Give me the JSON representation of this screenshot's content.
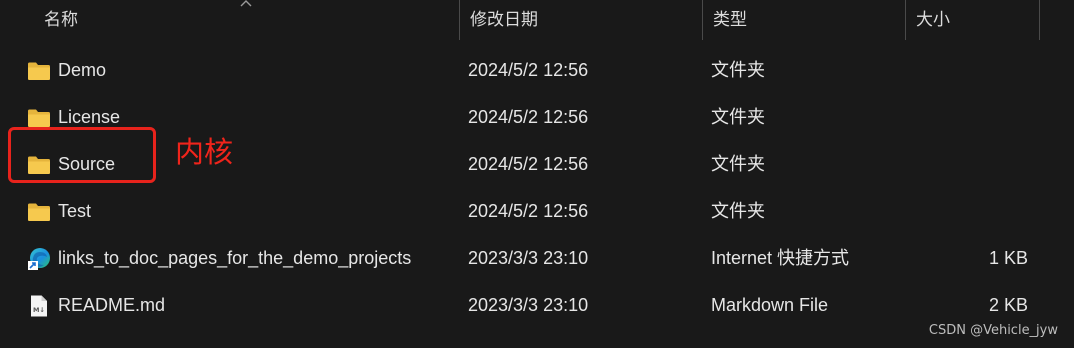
{
  "header": {
    "name": "名称",
    "date": "修改日期",
    "type": "类型",
    "size": "大小"
  },
  "rows": [
    {
      "name": "Demo",
      "date": "2024/5/2 12:56",
      "type": "文件夹",
      "size": "",
      "icon": "folder-icon"
    },
    {
      "name": "License",
      "date": "2024/5/2 12:56",
      "type": "文件夹",
      "size": "",
      "icon": "folder-icon"
    },
    {
      "name": "Source",
      "date": "2024/5/2 12:56",
      "type": "文件夹",
      "size": "",
      "icon": "folder-icon"
    },
    {
      "name": "Test",
      "date": "2024/5/2 12:56",
      "type": "文件夹",
      "size": "",
      "icon": "folder-icon"
    },
    {
      "name": "links_to_doc_pages_for_the_demo_projects",
      "date": "2023/3/3 23:10",
      "type": "Internet 快捷方式",
      "size": "1 KB",
      "icon": "internet-shortcut-icon"
    },
    {
      "name": "README.md",
      "date": "2023/3/3 23:10",
      "type": "Markdown File",
      "size": "2 KB",
      "icon": "markdown-file-icon"
    }
  ],
  "annotation": {
    "label": "内核",
    "color": "#e8231c"
  },
  "watermark": "CSDN @Vehicle_jyw",
  "colors": {
    "background": "#191919",
    "folder": "#f2c44a",
    "text": "#e6e6e6"
  }
}
